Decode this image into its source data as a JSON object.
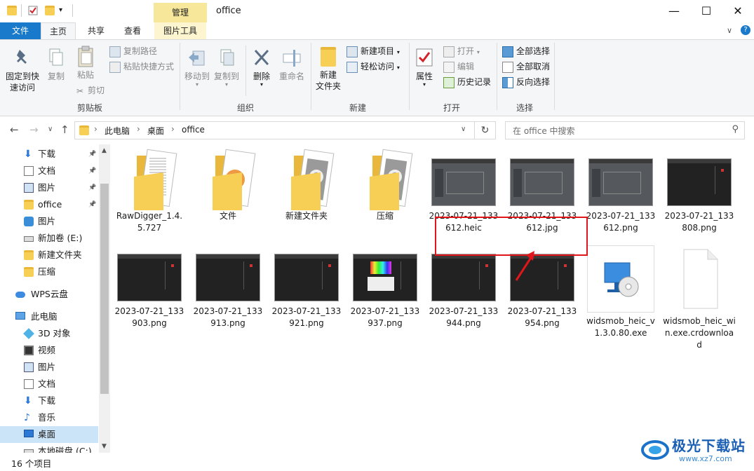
{
  "titlebar": {
    "manage_tab": "管理",
    "title": "office",
    "minimize": "—",
    "maximize": "☐",
    "close": "✕"
  },
  "tabs": {
    "file": "文件",
    "home": "主页",
    "share": "共享",
    "view": "查看",
    "picture_tools": "图片工具"
  },
  "ribbon": {
    "clipboard": {
      "label": "剪贴板",
      "pin_quick_access": [
        "固定到快",
        "速访问"
      ],
      "copy": "复制",
      "paste": "粘贴",
      "copy_path": "复制路径",
      "paste_shortcut": "粘贴快捷方式",
      "cut": "剪切"
    },
    "organize": {
      "label": "组织",
      "move_to": "移动到",
      "copy_to": "复制到",
      "delete": "删除",
      "rename": "重命名"
    },
    "new": {
      "label": "新建",
      "new_folder": [
        "新建",
        "文件夹"
      ],
      "new_item": "新建项目",
      "easy_access": "轻松访问"
    },
    "open": {
      "label": "打开",
      "properties": "属性",
      "open": "打开",
      "edit": "编辑",
      "history": "历史记录"
    },
    "select": {
      "label": "选择",
      "select_all": "全部选择",
      "select_none": "全部取消",
      "invert": "反向选择"
    }
  },
  "address": {
    "crumbs": [
      "此电脑",
      "桌面",
      "office"
    ],
    "search_placeholder": "在 office 中搜索"
  },
  "nav": {
    "items": [
      {
        "label": "下载",
        "icon": "download-icon",
        "pinned": true
      },
      {
        "label": "文档",
        "icon": "document-icon",
        "pinned": true
      },
      {
        "label": "图片",
        "icon": "picture-icon",
        "pinned": true
      },
      {
        "label": "office",
        "icon": "folder-icon",
        "pinned": true
      },
      {
        "label": "图片",
        "icon": "shield-folder-icon",
        "pinned": false
      },
      {
        "label": "新加卷 (E:)",
        "icon": "drive-icon",
        "pinned": false
      },
      {
        "label": "新建文件夹",
        "icon": "folder-icon",
        "pinned": false
      },
      {
        "label": "压缩",
        "icon": "folder-icon",
        "pinned": false
      },
      {
        "label": "WPS云盘",
        "icon": "cloud-icon",
        "pinned": false
      },
      {
        "label": "此电脑",
        "icon": "computer-icon",
        "pinned": false
      },
      {
        "label": "3D 对象",
        "icon": "cube-icon",
        "pinned": false
      },
      {
        "label": "视频",
        "icon": "video-icon",
        "pinned": false
      },
      {
        "label": "图片",
        "icon": "picture-icon",
        "pinned": false
      },
      {
        "label": "文档",
        "icon": "document-icon",
        "pinned": false
      },
      {
        "label": "下载",
        "icon": "download-icon",
        "pinned": false
      },
      {
        "label": "音乐",
        "icon": "music-icon",
        "pinned": false
      },
      {
        "label": "桌面",
        "icon": "desktop-icon",
        "pinned": false
      },
      {
        "label": "本地磁盘 (C:)",
        "icon": "drive-icon",
        "pinned": false
      }
    ]
  },
  "files": [
    {
      "name": "RawDigger_1.4.5.727",
      "kind": "folder-doc"
    },
    {
      "name": "文件",
      "kind": "folder-color"
    },
    {
      "name": "新建文件夹",
      "kind": "folder-gear"
    },
    {
      "name": "压缩",
      "kind": "folder-gear"
    },
    {
      "name": "2023-07-21_133612.heic",
      "kind": "shot-gray"
    },
    {
      "name": "2023-07-21_133612.jpg",
      "kind": "shot-gray"
    },
    {
      "name": "2023-07-21_133612.png",
      "kind": "shot-gray"
    },
    {
      "name": "2023-07-21_133808.png",
      "kind": "shot-dark"
    },
    {
      "name": "2023-07-21_133903.png",
      "kind": "shot-dark"
    },
    {
      "name": "2023-07-21_133913.png",
      "kind": "shot-dark"
    },
    {
      "name": "2023-07-21_133921.png",
      "kind": "shot-dark"
    },
    {
      "name": "2023-07-21_133937.png",
      "kind": "shot-color"
    },
    {
      "name": "2023-07-21_133944.png",
      "kind": "shot-dark"
    },
    {
      "name": "2023-07-21_133954.png",
      "kind": "shot-dark"
    },
    {
      "name": "widsmob_heic_v1.3.0.80.exe",
      "kind": "exe"
    },
    {
      "name": "widsmob_heic_win.exe.crdownload",
      "kind": "blank"
    }
  ],
  "status": {
    "count": "16 个项目"
  },
  "watermark": {
    "brand": "极光下载站",
    "url": "www.xz7.com"
  },
  "colors": {
    "file_tab": "#1979ca",
    "manage_tab": "#f6e79b",
    "selection": "#cce4f7",
    "annotation": "#e0161b"
  }
}
